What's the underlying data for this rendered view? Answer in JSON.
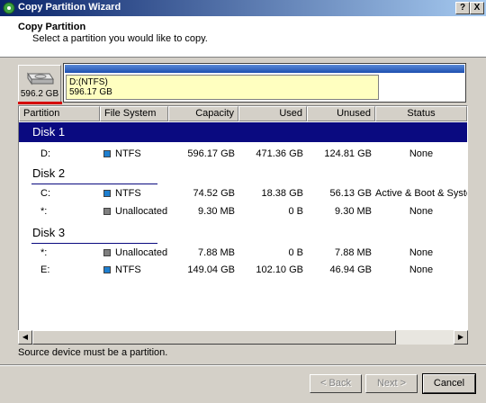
{
  "window": {
    "title": "Copy Partition Wizard",
    "help": "?",
    "close": "X"
  },
  "header": {
    "title": "Copy Partition",
    "subtitle": "Select a partition you would like to copy."
  },
  "disk_map": {
    "disk_size": "596.2 GB",
    "segment_label": "D:(NTFS)",
    "segment_size": "596.17 GB"
  },
  "columns": [
    "Partition",
    "File System",
    "Capacity",
    "Used",
    "Unused",
    "Status"
  ],
  "disks": [
    {
      "name": "Disk 1",
      "partitions": [
        {
          "partition": "D:",
          "fs": "NTFS",
          "fs_color": "#1e7fd0",
          "capacity": "596.17 GB",
          "used": "471.36 GB",
          "unused": "124.81 GB",
          "status": "None"
        }
      ]
    },
    {
      "name": "Disk 2",
      "partitions": [
        {
          "partition": "C:",
          "fs": "NTFS",
          "fs_color": "#1e7fd0",
          "capacity": "74.52 GB",
          "used": "18.38 GB",
          "unused": "56.13 GB",
          "status": "Active & Boot & System"
        },
        {
          "partition": "*:",
          "fs": "Unallocated",
          "fs_color": "#808080",
          "capacity": "9.30 MB",
          "used": "0 B",
          "unused": "9.30 MB",
          "status": "None"
        }
      ]
    },
    {
      "name": "Disk 3",
      "partitions": [
        {
          "partition": "*:",
          "fs": "Unallocated",
          "fs_color": "#808080",
          "capacity": "7.88 MB",
          "used": "0 B",
          "unused": "7.88 MB",
          "status": "None"
        },
        {
          "partition": "E:",
          "fs": "NTFS",
          "fs_color": "#1e7fd0",
          "capacity": "149.04 GB",
          "used": "102.10 GB",
          "unused": "46.94 GB",
          "status": "None"
        }
      ]
    }
  ],
  "message": "Source device must be a partition.",
  "buttons": {
    "back": "< Back",
    "next": "Next >",
    "cancel": "Cancel"
  },
  "colors": {
    "selection": "#0a0a80",
    "accent_red": "#d40000",
    "titlebar": "#0a246a"
  }
}
